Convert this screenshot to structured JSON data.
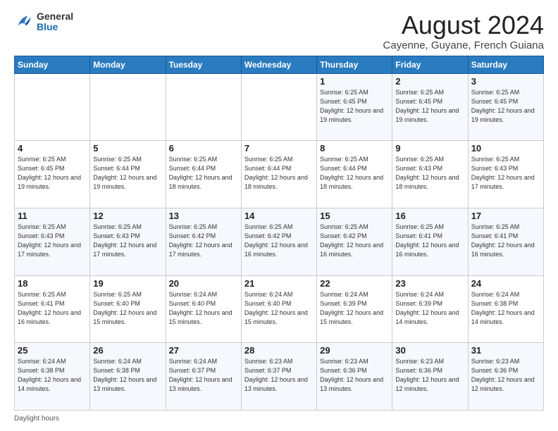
{
  "header": {
    "logo_general": "General",
    "logo_blue": "Blue",
    "title": "August 2024",
    "subtitle": "Cayenne, Guyane, French Guiana"
  },
  "days_of_week": [
    "Sunday",
    "Monday",
    "Tuesday",
    "Wednesday",
    "Thursday",
    "Friday",
    "Saturday"
  ],
  "weeks": [
    [
      {
        "day": "",
        "info": ""
      },
      {
        "day": "",
        "info": ""
      },
      {
        "day": "",
        "info": ""
      },
      {
        "day": "",
        "info": ""
      },
      {
        "day": "1",
        "info": "Sunrise: 6:25 AM\nSunset: 6:45 PM\nDaylight: 12 hours\nand 19 minutes."
      },
      {
        "day": "2",
        "info": "Sunrise: 6:25 AM\nSunset: 6:45 PM\nDaylight: 12 hours\nand 19 minutes."
      },
      {
        "day": "3",
        "info": "Sunrise: 6:25 AM\nSunset: 6:45 PM\nDaylight: 12 hours\nand 19 minutes."
      }
    ],
    [
      {
        "day": "4",
        "info": "Sunrise: 6:25 AM\nSunset: 6:45 PM\nDaylight: 12 hours\nand 19 minutes."
      },
      {
        "day": "5",
        "info": "Sunrise: 6:25 AM\nSunset: 6:44 PM\nDaylight: 12 hours\nand 19 minutes."
      },
      {
        "day": "6",
        "info": "Sunrise: 6:25 AM\nSunset: 6:44 PM\nDaylight: 12 hours\nand 18 minutes."
      },
      {
        "day": "7",
        "info": "Sunrise: 6:25 AM\nSunset: 6:44 PM\nDaylight: 12 hours\nand 18 minutes."
      },
      {
        "day": "8",
        "info": "Sunrise: 6:25 AM\nSunset: 6:44 PM\nDaylight: 12 hours\nand 18 minutes."
      },
      {
        "day": "9",
        "info": "Sunrise: 6:25 AM\nSunset: 6:43 PM\nDaylight: 12 hours\nand 18 minutes."
      },
      {
        "day": "10",
        "info": "Sunrise: 6:25 AM\nSunset: 6:43 PM\nDaylight: 12 hours\nand 17 minutes."
      }
    ],
    [
      {
        "day": "11",
        "info": "Sunrise: 6:25 AM\nSunset: 6:43 PM\nDaylight: 12 hours\nand 17 minutes."
      },
      {
        "day": "12",
        "info": "Sunrise: 6:25 AM\nSunset: 6:43 PM\nDaylight: 12 hours\nand 17 minutes."
      },
      {
        "day": "13",
        "info": "Sunrise: 6:25 AM\nSunset: 6:42 PM\nDaylight: 12 hours\nand 17 minutes."
      },
      {
        "day": "14",
        "info": "Sunrise: 6:25 AM\nSunset: 6:42 PM\nDaylight: 12 hours\nand 16 minutes."
      },
      {
        "day": "15",
        "info": "Sunrise: 6:25 AM\nSunset: 6:42 PM\nDaylight: 12 hours\nand 16 minutes."
      },
      {
        "day": "16",
        "info": "Sunrise: 6:25 AM\nSunset: 6:41 PM\nDaylight: 12 hours\nand 16 minutes."
      },
      {
        "day": "17",
        "info": "Sunrise: 6:25 AM\nSunset: 6:41 PM\nDaylight: 12 hours\nand 16 minutes."
      }
    ],
    [
      {
        "day": "18",
        "info": "Sunrise: 6:25 AM\nSunset: 6:41 PM\nDaylight: 12 hours\nand 16 minutes."
      },
      {
        "day": "19",
        "info": "Sunrise: 6:25 AM\nSunset: 6:40 PM\nDaylight: 12 hours\nand 15 minutes."
      },
      {
        "day": "20",
        "info": "Sunrise: 6:24 AM\nSunset: 6:40 PM\nDaylight: 12 hours\nand 15 minutes."
      },
      {
        "day": "21",
        "info": "Sunrise: 6:24 AM\nSunset: 6:40 PM\nDaylight: 12 hours\nand 15 minutes."
      },
      {
        "day": "22",
        "info": "Sunrise: 6:24 AM\nSunset: 6:39 PM\nDaylight: 12 hours\nand 15 minutes."
      },
      {
        "day": "23",
        "info": "Sunrise: 6:24 AM\nSunset: 6:39 PM\nDaylight: 12 hours\nand 14 minutes."
      },
      {
        "day": "24",
        "info": "Sunrise: 6:24 AM\nSunset: 6:38 PM\nDaylight: 12 hours\nand 14 minutes."
      }
    ],
    [
      {
        "day": "25",
        "info": "Sunrise: 6:24 AM\nSunset: 6:38 PM\nDaylight: 12 hours\nand 14 minutes."
      },
      {
        "day": "26",
        "info": "Sunrise: 6:24 AM\nSunset: 6:38 PM\nDaylight: 12 hours\nand 13 minutes."
      },
      {
        "day": "27",
        "info": "Sunrise: 6:24 AM\nSunset: 6:37 PM\nDaylight: 12 hours\nand 13 minutes."
      },
      {
        "day": "28",
        "info": "Sunrise: 6:23 AM\nSunset: 6:37 PM\nDaylight: 12 hours\nand 13 minutes."
      },
      {
        "day": "29",
        "info": "Sunrise: 6:23 AM\nSunset: 6:36 PM\nDaylight: 12 hours\nand 13 minutes."
      },
      {
        "day": "30",
        "info": "Sunrise: 6:23 AM\nSunset: 6:36 PM\nDaylight: 12 hours\nand 12 minutes."
      },
      {
        "day": "31",
        "info": "Sunrise: 6:23 AM\nSunset: 6:36 PM\nDaylight: 12 hours\nand 12 minutes."
      }
    ]
  ],
  "footer": {
    "daylight_label": "Daylight hours"
  }
}
